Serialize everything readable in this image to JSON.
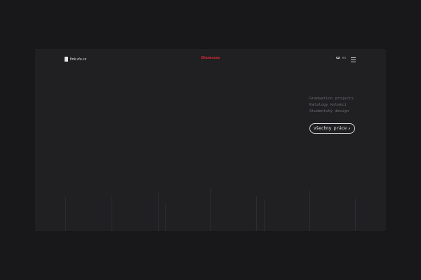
{
  "header": {
    "logo_text": "fink.vfu.cz",
    "title": "Showcase",
    "lang_active": "cz",
    "lang_other": "en"
  },
  "sidebar_links": [
    "Graduation projects",
    "Katalogy kolekcí",
    "Studentský design"
  ],
  "cta": {
    "label": "všechny práce",
    "arrow": "↗"
  },
  "icons": {
    "menu": "hamburger-icon",
    "logo": "logo-mark-icon",
    "arrow": "arrow-up-right-icon"
  },
  "colors": {
    "background": "#18171a",
    "panel": "#201f22",
    "accent": "#d92b3c",
    "link_muted": "#6f6e72"
  }
}
